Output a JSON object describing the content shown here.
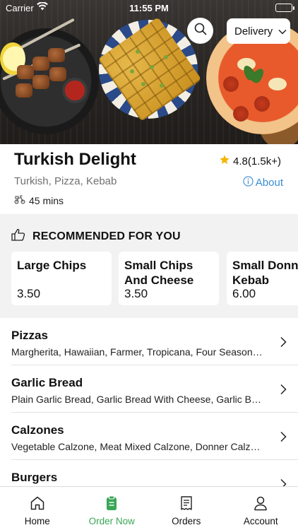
{
  "status_bar": {
    "carrier": "Carrier",
    "time": "11:55 PM"
  },
  "hero": {
    "delivery_label": "Delivery",
    "search_icon": "search-icon"
  },
  "restaurant": {
    "name": "Turkish Delight",
    "rating": "4.8(1.5k+)",
    "cuisine": "Turkish, Pizza, Kebab",
    "about_label": "About",
    "delivery_time": "45 mins"
  },
  "recommended": {
    "heading": "RECOMMENDED FOR YOU",
    "items": [
      {
        "name": "Large Chips",
        "price": "3.50"
      },
      {
        "name": "Small Chips\nAnd Cheese",
        "price": "3.50"
      },
      {
        "name": "Small Donner\nKebab",
        "price": "6.00"
      }
    ]
  },
  "menu": [
    {
      "title": "Pizzas",
      "items": "Margherita, Hawaiian, Farmer, Tropicana, Four Seasons, Pepperoni"
    },
    {
      "title": "Garlic Bread",
      "items": "Plain Garlic Bread, Garlic Bread With Cheese, Garlic Bread With Cheese & Tomato"
    },
    {
      "title": "Calzones",
      "items": "Vegetable Calzone, Meat Mixed Calzone, Donner Calzone"
    },
    {
      "title": "Burgers",
      "items": ""
    }
  ],
  "tabbar": {
    "tabs": [
      {
        "label": "Home",
        "icon": "home-icon",
        "active": false
      },
      {
        "label": "Order Now",
        "icon": "order-icon",
        "active": true
      },
      {
        "label": "Orders",
        "icon": "receipt-icon",
        "active": false
      },
      {
        "label": "Account",
        "icon": "account-icon",
        "active": false
      }
    ]
  },
  "colors": {
    "accent": "#3aa657",
    "link": "#3a8dd2",
    "star": "#f5b400",
    "section_bg": "#f2f2f2"
  }
}
